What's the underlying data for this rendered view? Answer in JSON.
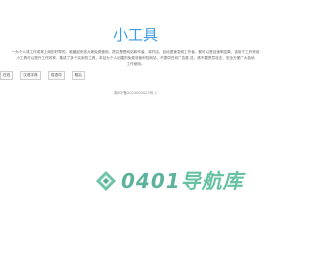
{
  "site": {
    "title": "小工具"
  },
  "intro": {
    "line1": "一为个人或工作或常上网的好帮的，收藏起来放大家免费使用。提议是是网站和作者。将开店，自动提速变频工作者，都可以是自速率结果，该用于工作采用",
    "line2": "小工具可以提升工作效率，集成了多个实用的工具，本站为个人创建的免费非营利性网站，不提供任何广告推 送，请不要恶意攻击，安全方便广大各地",
    "line3": "工作使用。"
  },
  "tags": [
    {
      "label": "在线"
    },
    {
      "label": "汉语字典"
    },
    {
      "label": "成语词"
    },
    {
      "label": "歇后"
    }
  ],
  "footer": {
    "icp": "湘ICP备2023000023号-1"
  },
  "watermark": {
    "ascii": "0401",
    "cjk": "导航库"
  },
  "colors": {
    "title": "#3d9be0",
    "watermark": "#3db08a"
  }
}
